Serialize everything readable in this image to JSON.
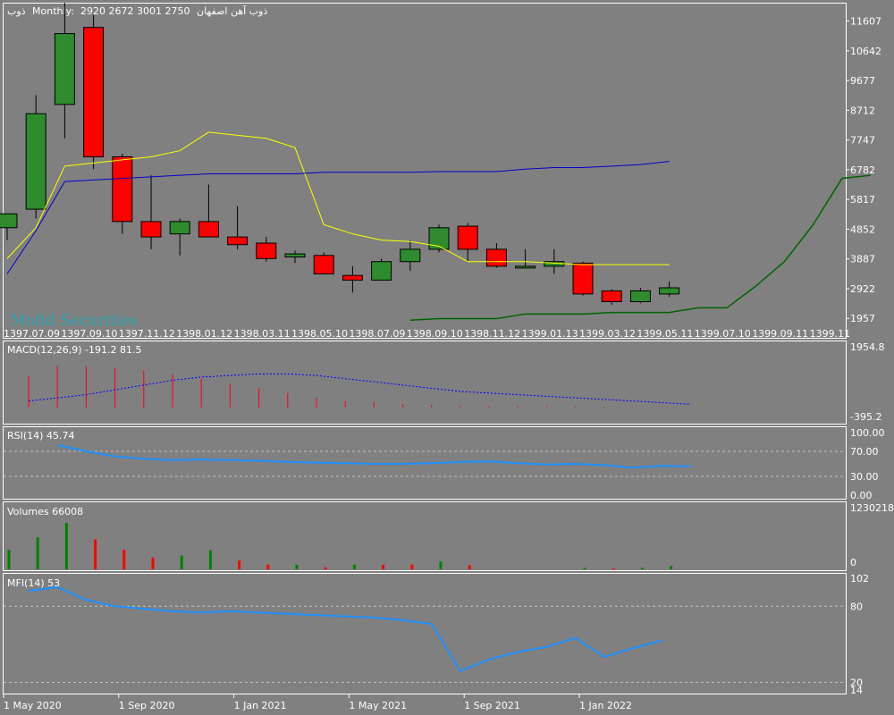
{
  "header": {
    "symbol": "ذوب",
    "timeframe": "Monthly:",
    "ohlc": "2920 2672 3001 2750",
    "name": "ذوب آهن اصفهان"
  },
  "watermark": "Mofid Securities",
  "colors": {
    "background": "#808080",
    "frame": "#ffffff",
    "bull": "#2e8b2e",
    "bear": "#ff0000",
    "sma_fast": "#ffff00",
    "sma_slow": "#0000cc",
    "chikou": "#006400",
    "macd_hist": "#ff0000",
    "macd_signal": "#0000ff",
    "rsi": "#1e90ff",
    "mfi": "#1e90ff",
    "vol_up": "#008000",
    "vol_down": "#ff0000"
  },
  "chart_data": [
    {
      "type": "candlestick",
      "panel": "price",
      "y_ticks": [
        "11607",
        "10642",
        "9677",
        "8712",
        "7747",
        "6782",
        "5817",
        "4852",
        "3887",
        "2922",
        "1957"
      ],
      "ylim": [
        1500,
        12000
      ],
      "x_ticks": [
        "1397.07.09",
        "1397.09.10",
        "1397.11.12",
        "1398.01.12",
        "1398.03.11",
        "1398.05.10",
        "1398.07.09",
        "1398.09.10",
        "1398.11.12",
        "1399.01.13",
        "1399.03.12",
        "1399.05.11",
        "1399.07.10",
        "1399.09.11",
        "1399.11"
      ],
      "candles": [
        {
          "o": 4900,
          "h": 5100,
          "l": 4500,
          "c": 5350
        },
        {
          "o": 5500,
          "h": 9200,
          "l": 5200,
          "c": 8600
        },
        {
          "o": 8900,
          "h": 12200,
          "l": 7800,
          "c": 11200
        },
        {
          "o": 11400,
          "h": 11800,
          "l": 6800,
          "c": 7200
        },
        {
          "o": 7200,
          "h": 7300,
          "l": 4700,
          "c": 5100
        },
        {
          "o": 5100,
          "h": 6600,
          "l": 4200,
          "c": 4600
        },
        {
          "o": 4700,
          "h": 5200,
          "l": 4000,
          "c": 5100
        },
        {
          "o": 5100,
          "h": 6300,
          "l": 4600,
          "c": 4600
        },
        {
          "o": 4600,
          "h": 5600,
          "l": 4200,
          "c": 4350
        },
        {
          "o": 4400,
          "h": 4600,
          "l": 3800,
          "c": 3900
        },
        {
          "o": 3950,
          "h": 4150,
          "l": 3750,
          "c": 4050
        },
        {
          "o": 4000,
          "h": 4100,
          "l": 3400,
          "c": 3400
        },
        {
          "o": 3350,
          "h": 3650,
          "l": 2800,
          "c": 3200
        },
        {
          "o": 3200,
          "h": 3900,
          "l": 3200,
          "c": 3800
        },
        {
          "o": 3800,
          "h": 4500,
          "l": 3500,
          "c": 4200
        },
        {
          "o": 4200,
          "h": 5000,
          "l": 4100,
          "c": 4900
        },
        {
          "o": 4950,
          "h": 5050,
          "l": 3800,
          "c": 4200
        },
        {
          "o": 4200,
          "h": 4400,
          "l": 3600,
          "c": 3650
        },
        {
          "o": 3650,
          "h": 4200,
          "l": 3600,
          "c": 3650
        },
        {
          "o": 3650,
          "h": 4200,
          "l": 3400,
          "c": 3800
        },
        {
          "o": 3750,
          "h": 3800,
          "l": 2700,
          "c": 2750
        },
        {
          "o": 2850,
          "h": 2900,
          "l": 2400,
          "c": 2500
        },
        {
          "o": 2500,
          "h": 2950,
          "l": 2450,
          "c": 2850
        },
        {
          "o": 2750,
          "h": 3150,
          "l": 2650,
          "c": 2950
        }
      ],
      "series": [
        {
          "values": [
            3900,
            4900,
            6900,
            7000,
            7100,
            7200,
            7400,
            8000,
            7900,
            7800,
            7500,
            5000,
            4700,
            4500,
            4450,
            4300,
            3800,
            3800,
            3800,
            3750,
            3700,
            3700,
            3700,
            3700
          ]
        },
        {
          "values": [
            3400,
            4800,
            6400,
            6450,
            6500,
            6550,
            6600,
            6650,
            6650,
            6650,
            6650,
            6700,
            6700,
            6700,
            6700,
            6720,
            6720,
            6720,
            6800,
            6850,
            6850,
            6900,
            6950,
            7050
          ]
        },
        {
          "start_index": 14,
          "values": [
            1900,
            1950,
            1950,
            1950,
            2100,
            2100,
            2100,
            2150,
            2150,
            2150,
            2300,
            2300,
            3000,
            3800,
            5000,
            6500,
            6600
          ]
        }
      ]
    },
    {
      "type": "bar",
      "panel": "macd",
      "title": "MACD(12,26,9) -191.2 81.5",
      "y_ticks": [
        "1954.8",
        "-395.2"
      ],
      "ylim": [
        -395.2,
        1954.8
      ],
      "histogram": [
        1000,
        1300,
        1300,
        1250,
        1150,
        1050,
        900,
        750,
        600,
        450,
        300,
        200,
        150,
        100,
        80,
        60,
        50,
        40,
        30,
        25,
        20,
        15,
        10,
        5
      ],
      "signal": [
        200,
        300,
        400,
        550,
        700,
        850,
        950,
        1000,
        1050,
        1050,
        1000,
        900,
        800,
        700,
        600,
        500,
        450,
        400,
        350,
        300,
        250,
        200,
        150,
        100
      ]
    },
    {
      "type": "line",
      "panel": "rsi",
      "title": "RSI(14) 45.74",
      "y_ticks": [
        "100.00",
        "70.00",
        "30.00",
        "0.00"
      ],
      "ylim": [
        0,
        100
      ],
      "values": [
        null,
        80,
        70,
        62,
        58,
        56,
        57,
        56,
        55,
        53,
        52,
        51,
        50,
        50,
        51,
        53,
        54,
        51,
        49,
        50,
        48,
        44,
        47,
        46
      ]
    },
    {
      "type": "bar",
      "panel": "volumes",
      "title": "Volumes 66008",
      "y_ticks": [
        "1230218",
        "0"
      ],
      "ylim": [
        0,
        1230218
      ],
      "values": [
        380000,
        620000,
        900000,
        580000,
        380000,
        230000,
        270000,
        370000,
        170000,
        90000,
        90000,
        40000,
        90000,
        90000,
        90000,
        150000,
        80000,
        0,
        0,
        0,
        30000,
        20000,
        30000,
        66008
      ],
      "directions": [
        "up",
        "up",
        "up",
        "down",
        "down",
        "down",
        "up",
        "up",
        "down",
        "down",
        "up",
        "down",
        "up",
        "down",
        "down",
        "up",
        "down",
        "up",
        "down",
        "up",
        "up",
        "down",
        "up",
        "up"
      ]
    },
    {
      "type": "line",
      "panel": "mfi",
      "title": "MFI(14) 53",
      "y_ticks": [
        "102",
        "80",
        "20",
        "14"
      ],
      "ylim": [
        14,
        102
      ],
      "values": [
        92,
        95,
        85,
        80,
        78,
        76,
        75,
        76,
        75,
        74,
        73,
        72,
        71,
        69,
        66,
        29,
        38,
        44,
        48,
        55,
        40,
        47,
        53
      ]
    }
  ],
  "x_axis": [
    "1 May 2020",
    "1 Sep 2020",
    "1 Jan 2021",
    "1 May 2021",
    "1 Sep 2021",
    "1 Jan 2022"
  ]
}
